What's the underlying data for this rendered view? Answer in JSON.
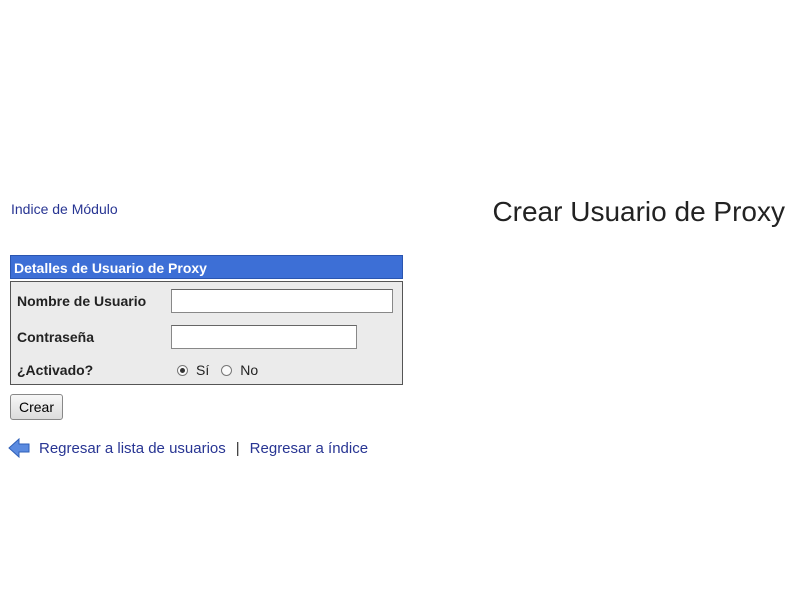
{
  "nav": {
    "module_index_label": "Indice de Módulo"
  },
  "page_title": "Crear Usuario de Proxy",
  "form": {
    "header": "Detalles de Usuario de Proxy",
    "username_label": "Nombre de Usuario",
    "username_value": "",
    "password_label": "Contraseña",
    "password_value": "",
    "activated_label": "¿Activado?",
    "activated_options": [
      "Sí",
      "No"
    ],
    "activated_selected": "Sí",
    "submit_label": "Crear"
  },
  "footer_links": {
    "back_to_users_label": "Regresar a lista de usuarios",
    "separator": "|",
    "back_to_index_label": "Regresar a índice"
  },
  "icons": {
    "back": "left-arrow-icon"
  },
  "colors": {
    "panel_header_bg": "#3d6fd6",
    "link": "#283593",
    "panel_body_bg": "#ebebeb"
  }
}
